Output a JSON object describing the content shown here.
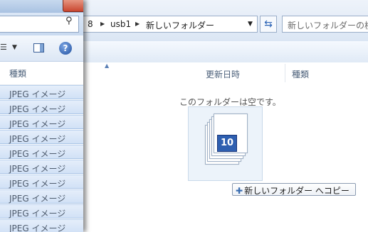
{
  "address_bar": {
    "path_segments": [
      "8",
      "usb1",
      "新しいフォルダー"
    ],
    "separator_icon": "chevron-right-icon",
    "dropdown_icon": "dropdown-arrow-icon",
    "refresh_icon": "refresh-icon",
    "search_placeholder": "新しいフォルダーの検"
  },
  "columns": {
    "date_modified": "更新日時",
    "type": "種類"
  },
  "empty_folder_message": "このフォルダーは空です。",
  "drag": {
    "media_badge": "10",
    "copy_tooltip": "新しいフォルダー へコピー",
    "copy_icon": "plus-icon"
  },
  "front_window": {
    "search_icon": "search-icon",
    "view_icon": "view-options-icon",
    "preview_icon": "preview-pane-icon",
    "help_icon": "help-icon",
    "column_type": "種類",
    "type_rows": [
      "JPEG イメージ",
      "JPEG イメージ",
      "JPEG イメージ",
      "JPEG イメージ",
      "JPEG イメージ",
      "JPEG イメージ",
      "JPEG イメージ",
      "JPEG イメージ",
      "JPEG イメージ",
      "JPEG イメージ"
    ]
  },
  "colors": {
    "accent": "#2b63b5",
    "row_selection": "#d1e1f6",
    "toolbar": "#dce7f5"
  }
}
